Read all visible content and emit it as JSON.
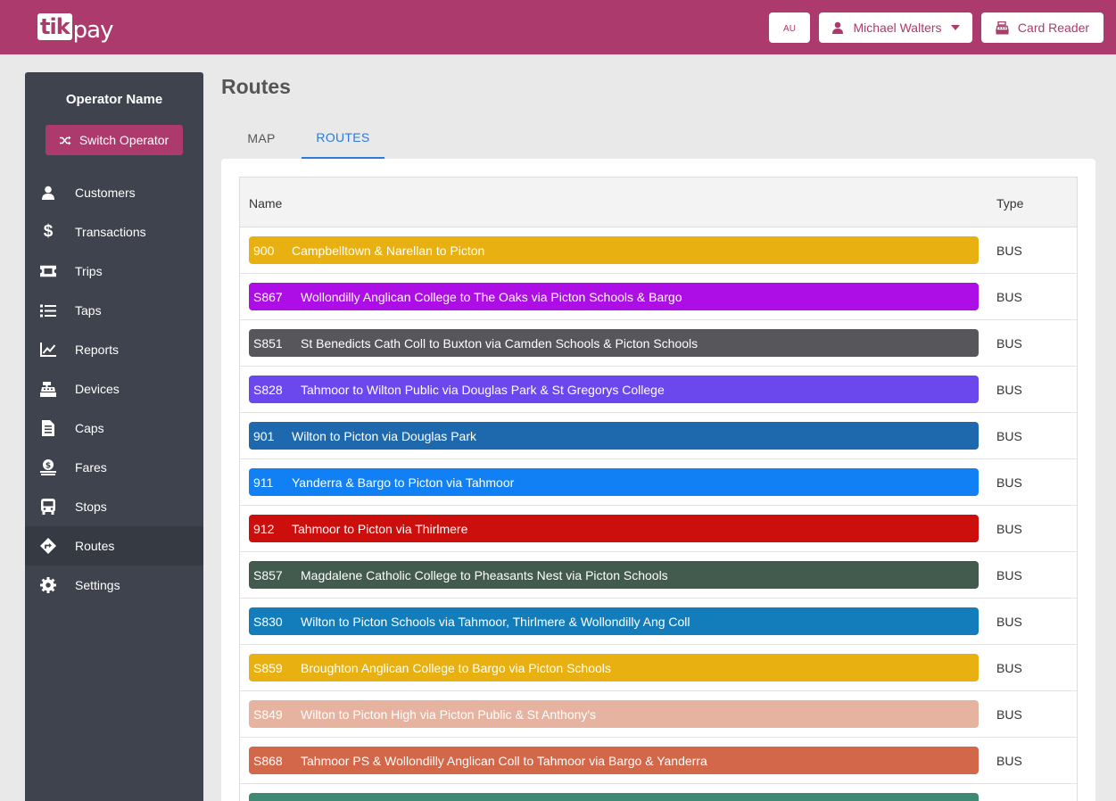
{
  "header": {
    "logo_box": "tik",
    "logo_text": "pay",
    "region": "AU",
    "user_name": "Michael Walters",
    "card_reader": "Card Reader",
    "brand_color": "#ad3a6c"
  },
  "sidebar": {
    "operator_name": "Operator Name",
    "switch_label": "Switch Operator",
    "items": [
      {
        "label": "Customers",
        "icon": "user-icon"
      },
      {
        "label": "Transactions",
        "icon": "dollar-icon"
      },
      {
        "label": "Trips",
        "icon": "ticket-icon"
      },
      {
        "label": "Taps",
        "icon": "list-icon"
      },
      {
        "label": "Reports",
        "icon": "chart-line-icon"
      },
      {
        "label": "Devices",
        "icon": "cash-register-icon"
      },
      {
        "label": "Caps",
        "icon": "file-invoice-icon"
      },
      {
        "label": "Fares",
        "icon": "hand-coin-icon"
      },
      {
        "label": "Stops",
        "icon": "bus-icon"
      },
      {
        "label": "Routes",
        "icon": "route-diamond-icon",
        "active": true
      },
      {
        "label": "Settings",
        "icon": "gear-icon"
      }
    ]
  },
  "page": {
    "title": "Routes",
    "tabs": [
      "MAP",
      "ROUTES"
    ],
    "active_tab": "ROUTES"
  },
  "table": {
    "columns": [
      "Name",
      "Type"
    ],
    "rows": [
      {
        "code": "900",
        "name": "Campbelltown & Narellan to Picton",
        "type": "BUS",
        "color": "#e8b010"
      },
      {
        "code": "S867",
        "name": "Wollondilly Anglican College to The Oaks via Picton Schools & Bargo",
        "type": "BUS",
        "color": "#ae0ee6"
      },
      {
        "code": "S851",
        "name": "St Benedicts Cath Coll to Buxton via Camden Schools & Picton Schools",
        "type": "BUS",
        "color": "#57565b"
      },
      {
        "code": "S828",
        "name": "Tahmoor to Wilton Public via Douglas Park & St Gregorys College",
        "type": "BUS",
        "color": "#6a48ee"
      },
      {
        "code": "901",
        "name": "Wilton to Picton via Douglas Park",
        "type": "BUS",
        "color": "#1e68ae"
      },
      {
        "code": "911",
        "name": "Yanderra & Bargo to Picton via Tahmoor",
        "type": "BUS",
        "color": "#1180f5"
      },
      {
        "code": "912",
        "name": "Tahmoor to Picton via Thirlmere",
        "type": "BUS",
        "color": "#cc0e0c"
      },
      {
        "code": "S857",
        "name": "Magdalene Catholic College to Pheasants Nest via Picton Schools",
        "type": "BUS",
        "color": "#435a4f"
      },
      {
        "code": "S830",
        "name": "Wilton to Picton Schools via Tahmoor, Thirlmere & Wollondilly Ang Coll",
        "type": "BUS",
        "color": "#137cba"
      },
      {
        "code": "S859",
        "name": "Broughton Anglican College to Bargo via Picton Schools",
        "type": "BUS",
        "color": "#e8b010"
      },
      {
        "code": "S849",
        "name": "Wilton to Picton High via Picton Public & St Anthony's",
        "type": "BUS",
        "color": "#e7b3a1"
      },
      {
        "code": "S868",
        "name": "Tahmoor PS & Wollondilly Anglican Coll to Tahmoor via Bargo & Yanderra",
        "type": "BUS",
        "color": "#d26749"
      },
      {
        "code": "",
        "name": "",
        "type": "",
        "color": "#3f8a74"
      }
    ]
  }
}
